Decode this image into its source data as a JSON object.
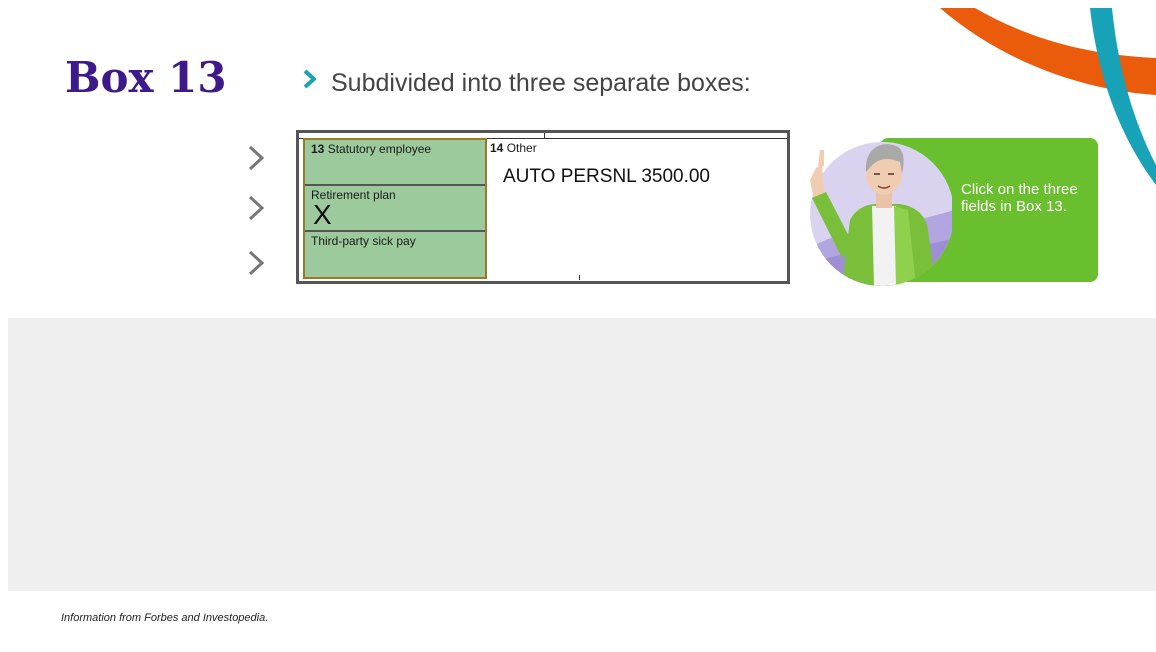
{
  "slide": {
    "title": "Box 13",
    "subtitle": "Subdivided into three separate boxes:",
    "bullet_icon": "chevron-right-icon",
    "bullet_color": "#1aa3b5",
    "title_color": "#3d1a8c"
  },
  "navigation": {
    "arrows": [
      {
        "icon": "chevron-right-icon"
      },
      {
        "icon": "chevron-right-icon"
      },
      {
        "icon": "chevron-right-icon"
      }
    ]
  },
  "w2_form": {
    "box13": {
      "highlight_color": "#9cca9c",
      "fields": [
        {
          "number": "13",
          "label": "Statutory employee",
          "value": ""
        },
        {
          "number": "",
          "label": "Retirement plan",
          "value": "X"
        },
        {
          "number": "",
          "label": "Third-party sick pay",
          "value": ""
        }
      ]
    },
    "box14": {
      "number": "14",
      "label": "Other",
      "value": "AUTO PERSNL 3500.00"
    }
  },
  "callout": {
    "text": "Click on the three fields in Box 13.",
    "background_color": "#6abf2e",
    "avatar_icon": "presenter-avatar"
  },
  "footer": {
    "source": "Information from Forbes and Investopedia."
  },
  "decorations": {
    "ribbon_orange": "#ea5b0c",
    "ribbon_teal": "#17a2b8"
  }
}
